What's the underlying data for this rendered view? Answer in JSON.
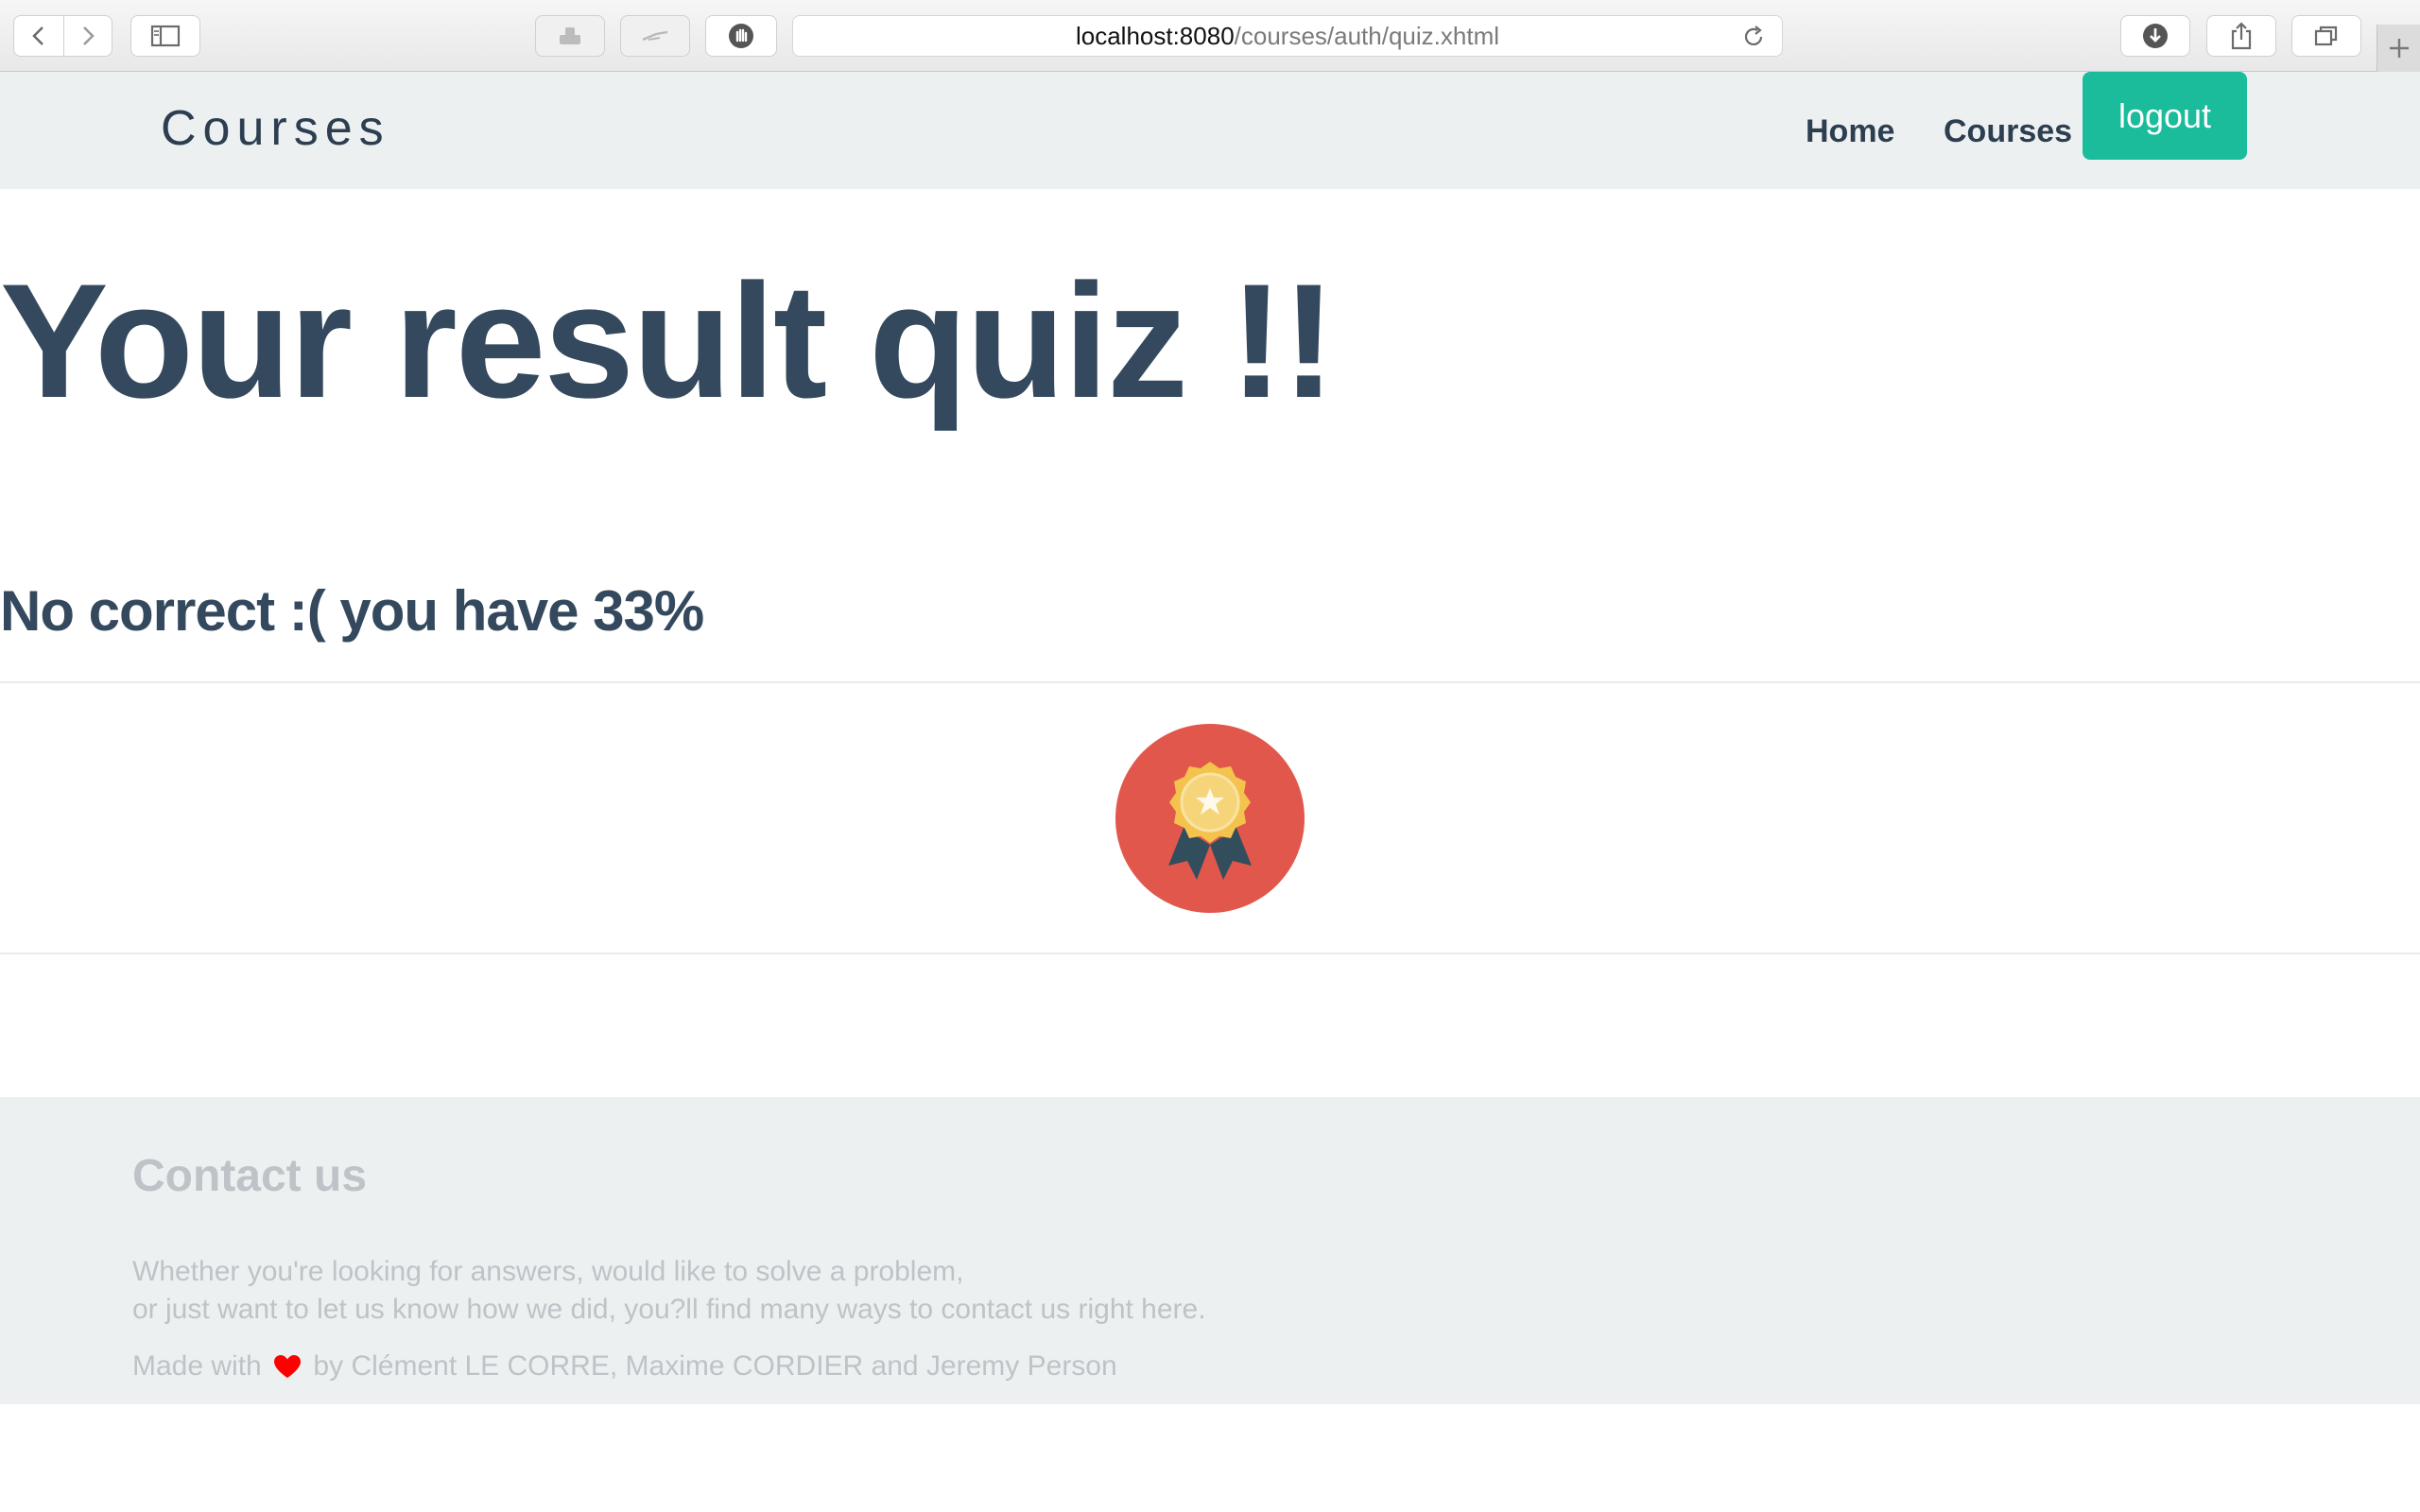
{
  "browser": {
    "url_host": "localhost:8080",
    "url_path": "/courses/auth/quiz.xhtml"
  },
  "navbar": {
    "brand": "Courses",
    "links": [
      {
        "label": "Home"
      },
      {
        "label": "Courses"
      }
    ],
    "logout_label": "logout"
  },
  "main": {
    "title": "Your result quiz !!",
    "result_text": "No correct :( you have 33%",
    "badge_icon": "award-medal-icon"
  },
  "footer": {
    "heading": "Contact us",
    "line1": "Whether you're looking for answers, would like to solve a problem,",
    "line2": "or just want to let us know how we did, you?ll find many ways to contact us right here.",
    "made_with": "Made with",
    "credits": "by Clément LE CORRE, Maxime CORDIER and Jeremy Person"
  },
  "colors": {
    "accent": "#1abc9c",
    "text_dark": "#34495e",
    "nav_bg": "#ecf0f1",
    "badge_red": "#e2574c",
    "heart": "#ff0000"
  }
}
